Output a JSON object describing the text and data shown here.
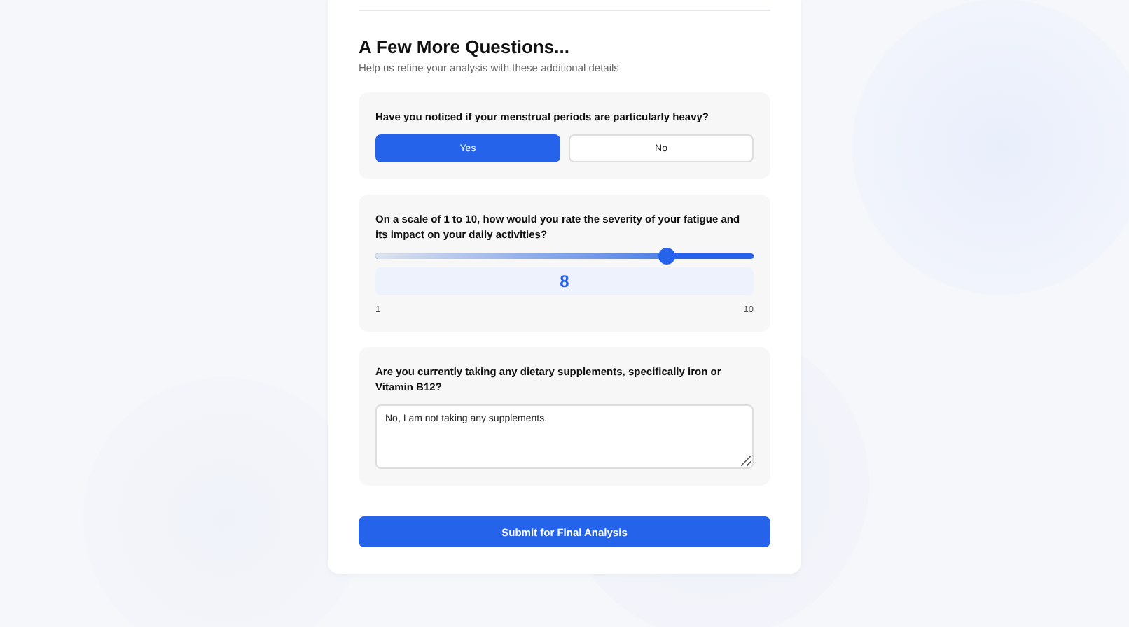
{
  "section": {
    "title": "A Few More Questions...",
    "subtitle": "Help us refine your analysis with these additional details"
  },
  "questions": [
    {
      "kind": "choice",
      "text": "Have you noticed if your menstrual periods are particularly heavy?",
      "options": [
        {
          "label": "Yes",
          "selected": true
        },
        {
          "label": "No",
          "selected": false
        }
      ]
    },
    {
      "kind": "slider",
      "text": "On a scale of 1 to 10, how would you rate the severity of your fatigue and its impact on your daily activities?",
      "level": 0.77,
      "reading": "8",
      "min_label": "1",
      "max_label": "10"
    },
    {
      "kind": "text",
      "text": "Are you currently taking any dietary supplements, specifically iron or Vitamin B12?",
      "value": "No, I am not taking any supplements."
    }
  ],
  "submit": {
    "label": "Submit for Final Analysis"
  }
}
